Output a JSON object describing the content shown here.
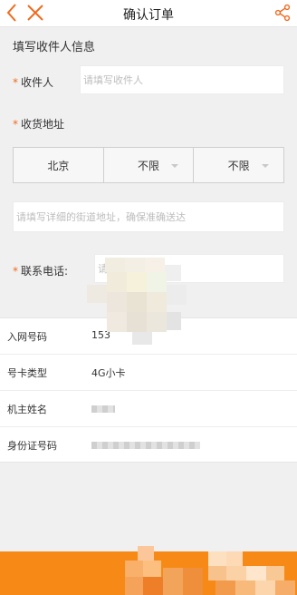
{
  "nav": {
    "title": "确认订单",
    "back_icon": "chevron-left-icon",
    "close_icon": "close-icon",
    "share_icon": "share-icon",
    "accent": "#f06a1d"
  },
  "form": {
    "section_title": "填写收件人信息",
    "required_mark": "*",
    "recipient": {
      "label": "收件人",
      "placeholder": "请填写收件人"
    },
    "address": {
      "label": "收货地址",
      "province": "北京",
      "city": "不限",
      "district": "不限"
    },
    "street": {
      "placeholder": "请填写详细的街道地址，确保准确送达"
    },
    "phone": {
      "label": "联系电话:",
      "placeholder": "请填"
    }
  },
  "order_info": [
    {
      "key": "入网号码",
      "value": "153"
    },
    {
      "key": "号卡类型",
      "value": "4G小卡"
    },
    {
      "key": "机主姓名",
      "value": ""
    },
    {
      "key": "身份证号码",
      "value": ""
    }
  ],
  "colors": {
    "bottom_bar": "#f78a16",
    "background": "#f0f0f0"
  }
}
